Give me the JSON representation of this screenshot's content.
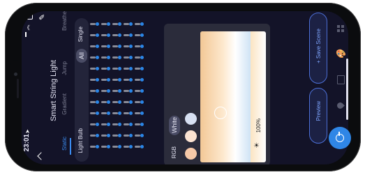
{
  "status": {
    "time": "23:01"
  },
  "header": {
    "title": "Smart String Light"
  },
  "tabs": [
    {
      "label": "Static",
      "active": true
    },
    {
      "label": "Gradient",
      "active": false
    },
    {
      "label": "Jump",
      "active": false
    },
    {
      "label": "Breathe",
      "active": false
    }
  ],
  "device": {
    "label": "Light Bulb"
  },
  "selector": {
    "all": "All",
    "single": "Single"
  },
  "color_panel": {
    "rgb_label": "RGB",
    "white_label": "White",
    "brightness": "100%",
    "swatches": [
      "#f6c9a8",
      "#fbe3d2",
      "#d7e0f2"
    ]
  },
  "actions": {
    "preview": "Preview",
    "save_scene": "+ Save Scene"
  },
  "colors": {
    "accent": "#2f86e6",
    "background": "#131328",
    "panel": "#2b2c3b"
  },
  "sidebar_icons": [
    "grid-icon",
    "palette-icon",
    "scene-icon",
    "drop-icon"
  ]
}
